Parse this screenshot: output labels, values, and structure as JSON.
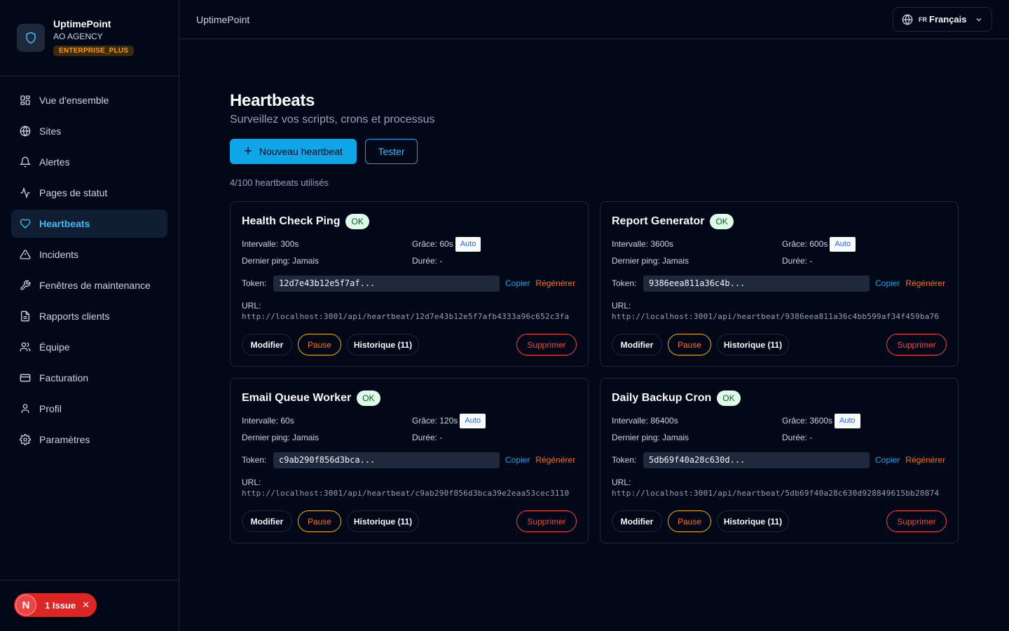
{
  "brand": {
    "name": "UptimePoint",
    "org": "AO AGENCY",
    "plan": "ENTERPRISE_PLUS"
  },
  "nav": [
    {
      "label": "Vue d'ensemble",
      "icon": "grid-icon"
    },
    {
      "label": "Sites",
      "icon": "globe-icon"
    },
    {
      "label": "Alertes",
      "icon": "bell-icon"
    },
    {
      "label": "Pages de statut",
      "icon": "activity-icon"
    },
    {
      "label": "Heartbeats",
      "icon": "heart-icon",
      "active": true
    },
    {
      "label": "Incidents",
      "icon": "warning-icon"
    },
    {
      "label": "Fenêtres de maintenance",
      "icon": "wrench-icon"
    },
    {
      "label": "Rapports clients",
      "icon": "document-icon"
    },
    {
      "label": "Équipe",
      "icon": "users-icon"
    },
    {
      "label": "Facturation",
      "icon": "credit-card-icon"
    },
    {
      "label": "Profil",
      "icon": "user-icon"
    },
    {
      "label": "Paramètres",
      "icon": "gear-icon"
    }
  ],
  "issue": {
    "letter": "N",
    "label": "1 Issue"
  },
  "topbar": {
    "title": "UptimePoint",
    "lang_code": "FR",
    "lang_name": "Français"
  },
  "page": {
    "title": "Heartbeats",
    "subtitle": "Surveillez vos scripts, crons et processus",
    "new_button": "Nouveau heartbeat",
    "test_button": "Tester",
    "usage": "4/100 heartbeats utilisés"
  },
  "labels": {
    "ok": "OK",
    "auto": "Auto",
    "token": "Token:",
    "copy": "Copier",
    "regenerate": "Régénérer",
    "url": "URL:",
    "edit": "Modifier",
    "pause": "Pause",
    "history": "Historique (11)",
    "delete": "Supprimer"
  },
  "heartbeats": [
    {
      "name": "Health Check Ping",
      "interval": "Intervalle: 300s",
      "grace": "Grâce: 60s",
      "last_ping": "Dernier ping: Jamais",
      "duration": "Durée: -",
      "token": "12d7e43b12e5f7af...",
      "url": "http://localhost:3001/api/heartbeat/12d7e43b12e5f7afb4333a96c652c3fa"
    },
    {
      "name": "Report Generator",
      "interval": "Intervalle: 3600s",
      "grace": "Grâce: 600s",
      "last_ping": "Dernier ping: Jamais",
      "duration": "Durée: -",
      "token": "9386eea811a36c4b...",
      "url": "http://localhost:3001/api/heartbeat/9386eea811a36c4bb599af34f459ba76"
    },
    {
      "name": "Email Queue Worker",
      "interval": "Intervalle: 60s",
      "grace": "Grâce: 120s",
      "last_ping": "Dernier ping: Jamais",
      "duration": "Durée: -",
      "token": "c9ab290f856d3bca...",
      "url": "http://localhost:3001/api/heartbeat/c9ab290f856d3bca39e2eaa53cec3110"
    },
    {
      "name": "Daily Backup Cron",
      "interval": "Intervalle: 86400s",
      "grace": "Grâce: 3600s",
      "last_ping": "Dernier ping: Jamais",
      "duration": "Durée: -",
      "token": "5db69f40a28c630d...",
      "url": "http://localhost:3001/api/heartbeat/5db69f40a28c630d928849615bb20874"
    }
  ],
  "colors": {
    "accent": "#0ea5e9",
    "ok_bg": "#dcfce7",
    "danger": "#ef4444",
    "warning": "#f97316"
  }
}
